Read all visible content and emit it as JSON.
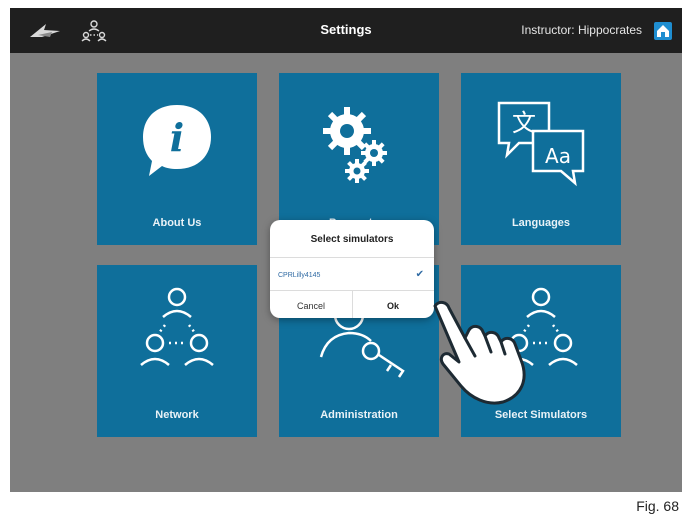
{
  "topbar": {
    "title": "Settings",
    "instructor": "Instructor: Hippocrates",
    "icons": [
      "logo-icon",
      "network-icon",
      "home-icon"
    ]
  },
  "tiles": [
    {
      "label": "About Us",
      "icon": "info-bubble-icon"
    },
    {
      "label": "Parameters",
      "icon": "gears-icon"
    },
    {
      "label": "Languages",
      "icon": "translate-icon"
    },
    {
      "label": "Network",
      "icon": "network-nodes-icon"
    },
    {
      "label": "Administration",
      "icon": "user-key-icon"
    },
    {
      "label": "Select Simulators",
      "icon": "network-nodes-icon"
    }
  ],
  "dialog": {
    "title": "Select simulators",
    "item": "CPRLilly4145",
    "item_checked": true,
    "cancel_label": "Cancel",
    "ok_label": "Ok"
  },
  "figure_label": "Fig. 68",
  "colors": {
    "tile": "#0f6f9b",
    "background": "#7f7f7f",
    "topbar": "#1f1f1f",
    "home": "#1f8ed1"
  }
}
